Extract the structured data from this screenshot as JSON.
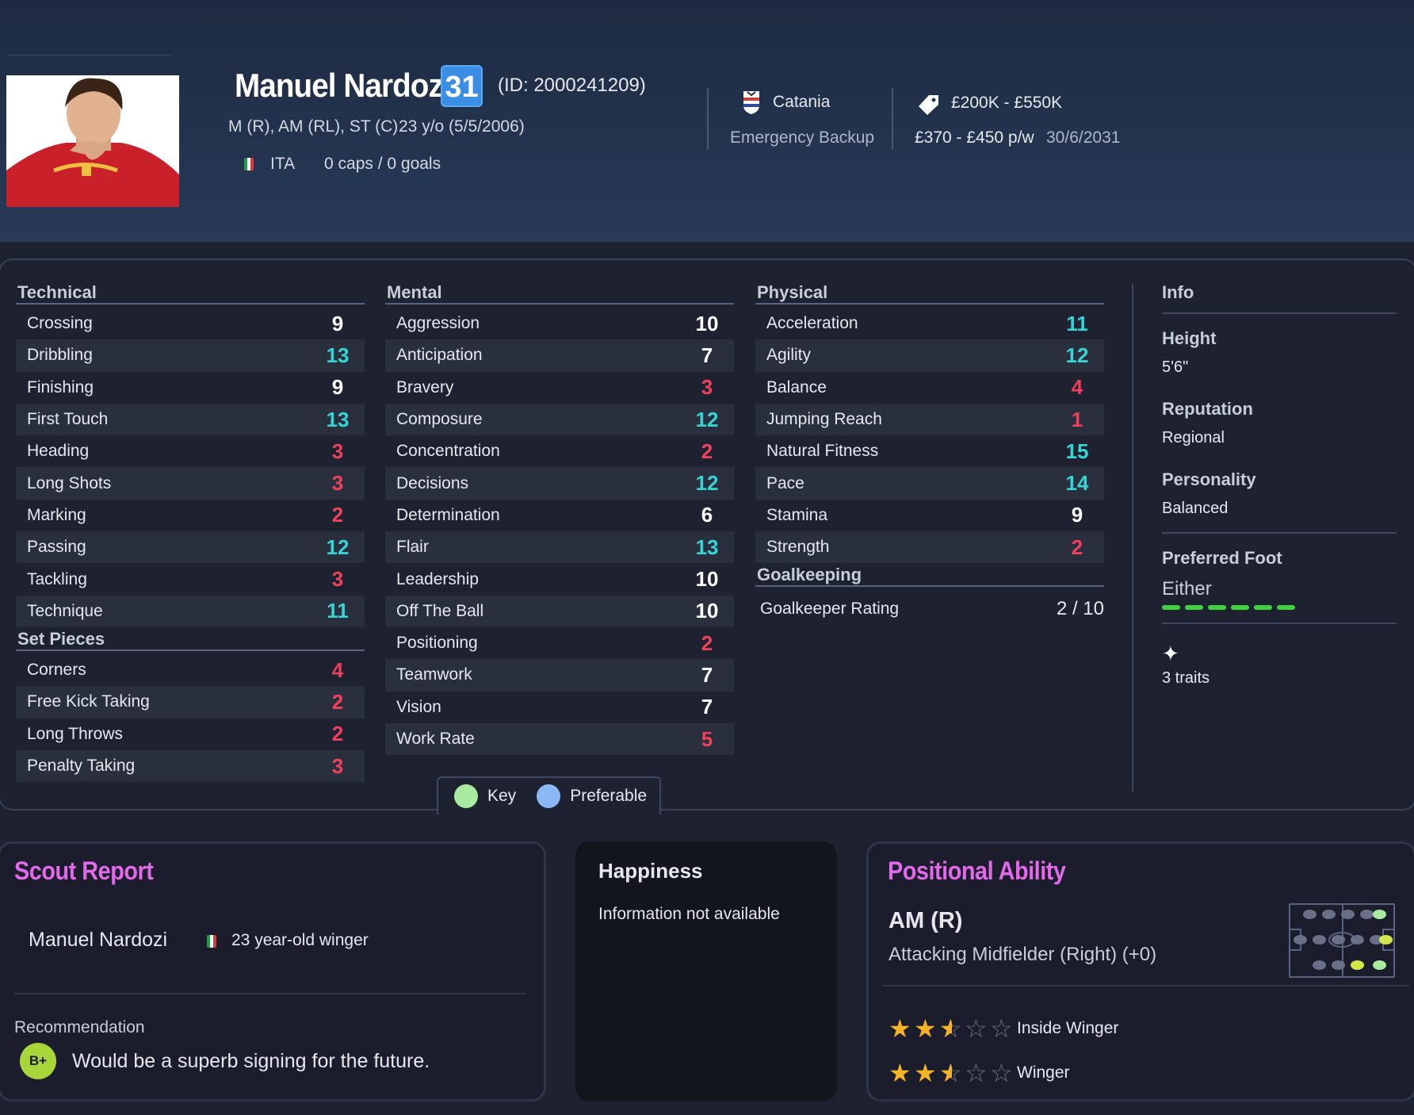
{
  "player": {
    "name": "Manuel Nardozi",
    "ca": "31",
    "id_text": "(ID: 2000241209)",
    "positions": "M (R), AM (RL), ST (C)",
    "age_dob": "23 y/o (5/5/2006)",
    "nation": "ITA",
    "caps": "0 caps / 0 goals"
  },
  "club": {
    "name": "Catania",
    "squad_status": "Emergency Backup"
  },
  "contract": {
    "value": "£200K - £550K",
    "wage": "£370 - £450 p/w",
    "expires": "30/6/2031"
  },
  "technical": {
    "title": "Technical",
    "rows": [
      {
        "name": "Crossing",
        "value": "9",
        "level": "mid"
      },
      {
        "name": "Dribbling",
        "value": "13",
        "level": "high"
      },
      {
        "name": "Finishing",
        "value": "9",
        "level": "mid"
      },
      {
        "name": "First Touch",
        "value": "13",
        "level": "high"
      },
      {
        "name": "Heading",
        "value": "3",
        "level": "low"
      },
      {
        "name": "Long Shots",
        "value": "3",
        "level": "low"
      },
      {
        "name": "Marking",
        "value": "2",
        "level": "low"
      },
      {
        "name": "Passing",
        "value": "12",
        "level": "high"
      },
      {
        "name": "Tackling",
        "value": "3",
        "level": "low"
      },
      {
        "name": "Technique",
        "value": "11",
        "level": "high"
      }
    ]
  },
  "set_pieces": {
    "title": "Set Pieces",
    "rows": [
      {
        "name": "Corners",
        "value": "4",
        "level": "low"
      },
      {
        "name": "Free Kick Taking",
        "value": "2",
        "level": "low"
      },
      {
        "name": "Long Throws",
        "value": "2",
        "level": "low"
      },
      {
        "name": "Penalty Taking",
        "value": "3",
        "level": "low"
      }
    ]
  },
  "mental": {
    "title": "Mental",
    "rows": [
      {
        "name": "Aggression",
        "value": "10",
        "level": "mid"
      },
      {
        "name": "Anticipation",
        "value": "7",
        "level": "mid"
      },
      {
        "name": "Bravery",
        "value": "3",
        "level": "low"
      },
      {
        "name": "Composure",
        "value": "12",
        "level": "high"
      },
      {
        "name": "Concentration",
        "value": "2",
        "level": "low"
      },
      {
        "name": "Decisions",
        "value": "12",
        "level": "high"
      },
      {
        "name": "Determination",
        "value": "6",
        "level": "mid"
      },
      {
        "name": "Flair",
        "value": "13",
        "level": "high"
      },
      {
        "name": "Leadership",
        "value": "10",
        "level": "mid"
      },
      {
        "name": "Off The Ball",
        "value": "10",
        "level": "mid"
      },
      {
        "name": "Positioning",
        "value": "2",
        "level": "low"
      },
      {
        "name": "Teamwork",
        "value": "7",
        "level": "mid"
      },
      {
        "name": "Vision",
        "value": "7",
        "level": "mid"
      },
      {
        "name": "Work Rate",
        "value": "5",
        "level": "low"
      }
    ]
  },
  "physical": {
    "title": "Physical",
    "rows": [
      {
        "name": "Acceleration",
        "value": "11",
        "level": "high"
      },
      {
        "name": "Agility",
        "value": "12",
        "level": "high"
      },
      {
        "name": "Balance",
        "value": "4",
        "level": "low"
      },
      {
        "name": "Jumping Reach",
        "value": "1",
        "level": "low"
      },
      {
        "name": "Natural Fitness",
        "value": "15",
        "level": "high"
      },
      {
        "name": "Pace",
        "value": "14",
        "level": "high"
      },
      {
        "name": "Stamina",
        "value": "9",
        "level": "mid"
      },
      {
        "name": "Strength",
        "value": "2",
        "level": "low"
      }
    ]
  },
  "goalkeeping": {
    "title": "Goalkeeping",
    "label": "Goalkeeper Rating",
    "value": "2 / 10"
  },
  "info": {
    "title": "Info",
    "height_label": "Height",
    "height": "5'6\"",
    "reputation_label": "Reputation",
    "reputation": "Regional",
    "personality_label": "Personality",
    "personality": "Balanced",
    "foot_label": "Preferred Foot",
    "foot": "Either",
    "traits": "3 traits"
  },
  "legend": {
    "key": "Key",
    "preferable": "Preferable"
  },
  "scout": {
    "title": "Scout Report",
    "player": "Manuel Nardozi",
    "summary": "23 year-old winger",
    "rec_label": "Recommendation",
    "grade": "B+",
    "recommendation": "Would be a superb signing for the future."
  },
  "happiness": {
    "title": "Happiness",
    "text": "Information not available"
  },
  "positional": {
    "title": "Positional Ability",
    "position": "AM (R)",
    "role": "Attacking Midfielder (Right) (+0)",
    "roles": [
      {
        "name": "Inside Winger",
        "stars": 2.5
      },
      {
        "name": "Winger",
        "stars": 2.5
      }
    ]
  },
  "colors": {
    "high": "#35d5d5",
    "low": "#f0405a",
    "mid": "#ffffff",
    "accent_pink": "#e26ae8",
    "key_green": "#a8eaa0",
    "preferable_blue": "#8ab8f5",
    "foot_green": "#3ed23e"
  }
}
